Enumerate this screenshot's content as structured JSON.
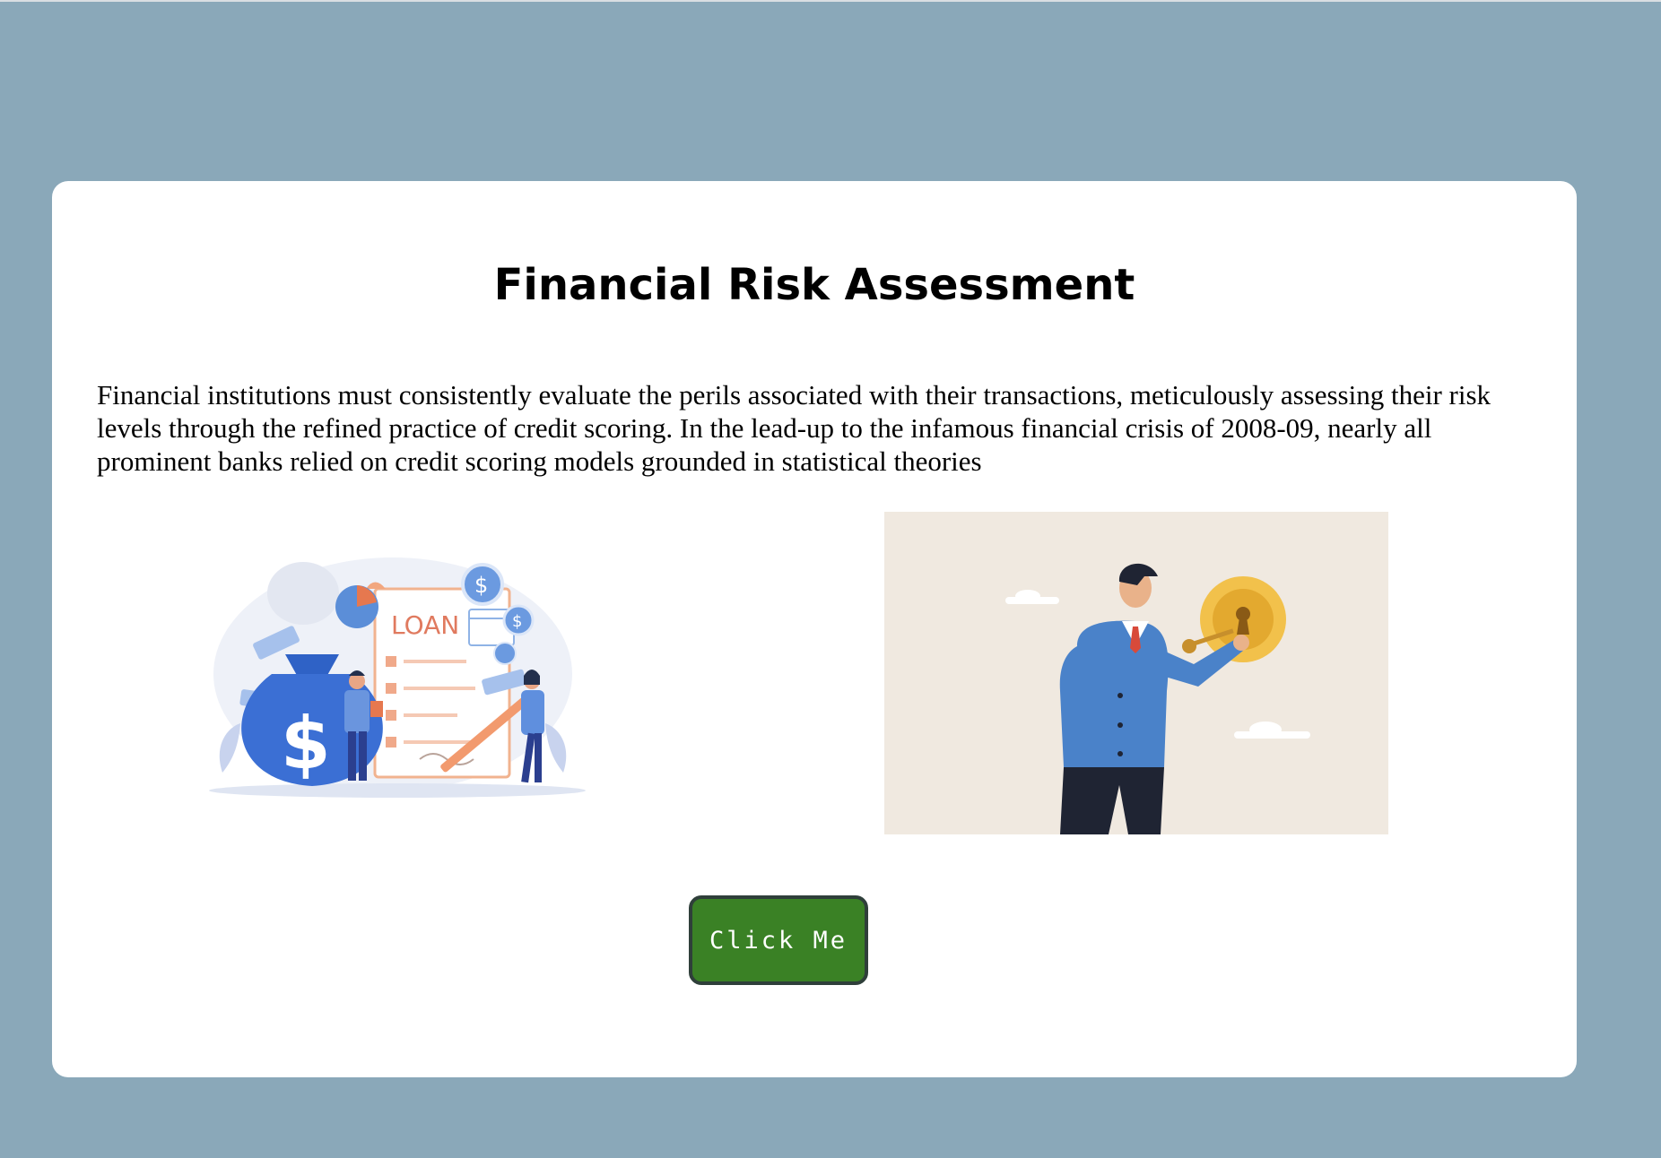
{
  "card": {
    "title": "Financial Risk Assessment",
    "intro": "Financial institutions must consistently evaluate the perils associated with their transactions, meticulously assessing their risk levels through the refined practice of credit scoring. In the lead-up to the infamous financial crisis of 2008-09, nearly all prominent banks relied on credit scoring models grounded in statistical theories",
    "images": {
      "loan": {
        "text": "LOAN",
        "icon": "loan-illustration"
      },
      "key": {
        "icon": "key-coin-illustration"
      }
    },
    "button_label": "Click Me"
  },
  "colors": {
    "page_background": "#8aa8b9",
    "card_background": "#ffffff",
    "button_background": "#3a8125",
    "button_text": "#ffffff"
  }
}
